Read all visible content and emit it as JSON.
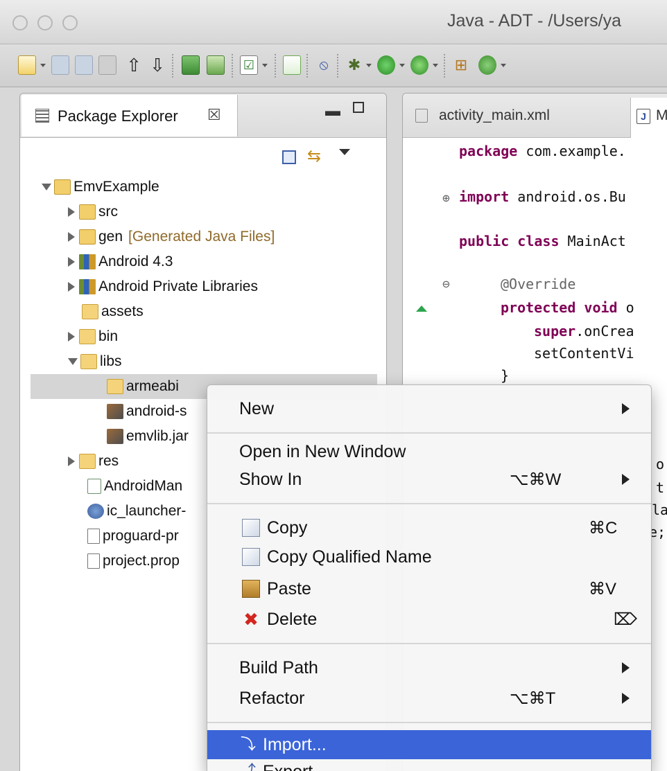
{
  "window": {
    "title": "Java - ADT - /Users/ya"
  },
  "package_explorer": {
    "tab_label": "Package Explorer",
    "close_glyph": "☒",
    "tree": [
      {
        "label": "EmvExample",
        "icon": "project-icon",
        "twisty": "open"
      },
      {
        "label": "src",
        "icon": "source-folder-icon",
        "twisty": "closed"
      },
      {
        "label": "gen",
        "note": "[Generated Java Files]",
        "icon": "generated-folder-icon",
        "twisty": "closed"
      },
      {
        "label": "Android 4.3",
        "icon": "library-icon",
        "twisty": "closed"
      },
      {
        "label": "Android Private Libraries",
        "icon": "library-icon",
        "twisty": "closed"
      },
      {
        "label": "assets",
        "icon": "folder-icon",
        "twisty": "none"
      },
      {
        "label": "bin",
        "icon": "folder-icon",
        "twisty": "closed"
      },
      {
        "label": "libs",
        "icon": "folder-icon",
        "twisty": "open"
      },
      {
        "label": "armeabi",
        "icon": "folder-icon",
        "twisty": "none"
      },
      {
        "label": "android-s",
        "icon": "jar-icon",
        "twisty": "none"
      },
      {
        "label": "emvlib.jar",
        "icon": "jar-icon",
        "twisty": "none"
      },
      {
        "label": "res",
        "icon": "folder-icon",
        "twisty": "closed"
      },
      {
        "label": "AndroidMan",
        "icon": "xml-file-icon",
        "twisty": "none"
      },
      {
        "label": "ic_launcher-",
        "icon": "image-file-icon",
        "twisty": "none"
      },
      {
        "label": "proguard-pr",
        "icon": "text-file-icon",
        "twisty": "none"
      },
      {
        "label": "project.prop",
        "icon": "text-file-icon",
        "twisty": "none"
      }
    ]
  },
  "editor": {
    "tab1_label": "activity_main.xml",
    "tab2_icon_letter": "J",
    "code_lines": [
      {
        "kw": "package",
        "rest": " com.example."
      },
      {
        "kw": "import",
        "rest": " android.os.Bu"
      },
      {
        "kw": "public class",
        "rest": " MainAct"
      },
      {
        "ann": "@Override",
        "rest": ""
      },
      {
        "kw": "protected void",
        "rest": " o"
      },
      {
        "kw": "super",
        "rest": ".onCrea"
      },
      {
        "kw": "",
        "rest": "setContentVi"
      },
      {
        "kw": "",
        "rest": "}"
      }
    ],
    "fragment_chars": [
      "o",
      "t",
      "la",
      "e;"
    ]
  },
  "context_menu": {
    "items": [
      {
        "label": "New",
        "shortcut": "",
        "submenu": true
      },
      {
        "label": "Open in New Window",
        "shortcut": "",
        "submenu": false
      },
      {
        "label": "Show In",
        "shortcut": "⌥⌘W",
        "submenu": true
      },
      {
        "label": "Copy",
        "shortcut": "⌘C",
        "submenu": false,
        "icon": "copy-icon"
      },
      {
        "label": "Copy Qualified Name",
        "shortcut": "",
        "submenu": false,
        "icon": "copy-qualified-icon"
      },
      {
        "label": "Paste",
        "shortcut": "⌘V",
        "submenu": false,
        "icon": "paste-icon"
      },
      {
        "label": "Delete",
        "shortcut": "⌦",
        "submenu": false,
        "icon": "delete-icon"
      },
      {
        "label": "Build Path",
        "shortcut": "",
        "submenu": true
      },
      {
        "label": "Refactor",
        "shortcut": "⌥⌘T",
        "submenu": true
      },
      {
        "label": "Import...",
        "shortcut": "",
        "submenu": false,
        "icon": "import-icon",
        "highlighted": true
      },
      {
        "label": "Export...",
        "shortcut": "",
        "submenu": false,
        "icon": "export-icon"
      }
    ]
  },
  "colors": {
    "menu_highlight": "#3a64d8",
    "keyword": "#7f0055",
    "generated_note": "#8f6a2a"
  }
}
